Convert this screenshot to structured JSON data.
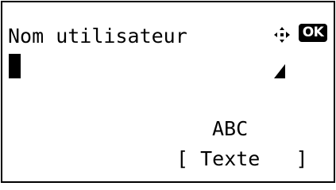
{
  "screen": {
    "title": "Nom utilisateur",
    "ok_label": "OK",
    "nav_icon": "four-way-navigation-icon",
    "input_value": "",
    "input_mode": "ABC",
    "softkey_label": "[ Texte   ]"
  }
}
